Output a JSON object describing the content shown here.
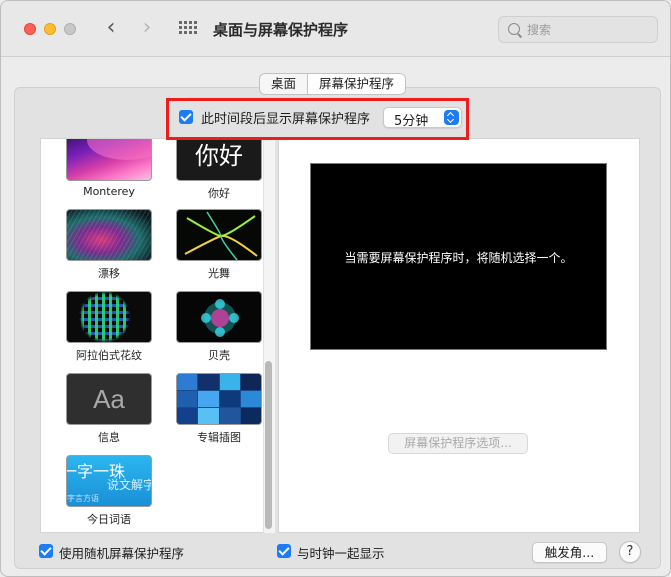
{
  "window": {
    "title": "桌面与屏幕保护程序",
    "search_placeholder": "搜索"
  },
  "icons": {
    "back": "chevron-left-icon",
    "forward": "chevron-right-icon",
    "show_all": "grid-icon",
    "search": "search-icon",
    "stepper": "chevron-up-down-icon"
  },
  "tabs": [
    {
      "label": "桌面",
      "active": false
    },
    {
      "label": "屏幕保护程序",
      "active": true
    }
  ],
  "start_after": {
    "checked": true,
    "label": "此时间段后显示屏幕保护程序",
    "value": "5分钟"
  },
  "savers": [
    {
      "label": "Monterey",
      "thumb_text": ""
    },
    {
      "label": "你好",
      "thumb_text": "你好"
    },
    {
      "label": "漂移",
      "thumb_text": ""
    },
    {
      "label": "光舞",
      "thumb_text": ""
    },
    {
      "label": "阿拉伯式花纹",
      "thumb_text": ""
    },
    {
      "label": "贝壳",
      "thumb_text": ""
    },
    {
      "label": "信息",
      "thumb_text": "Aa"
    },
    {
      "label": "专辑插图",
      "thumb_text": ""
    },
    {
      "label": "今日词语",
      "thumb_text_1": "一字一珠",
      "thumb_text_2": "说文解字",
      "thumb_text_3": "字言方语"
    }
  ],
  "preview": {
    "message": "当需要屏幕保护程序时，将随机选择一个。",
    "options_button": "屏幕保护程序选项..."
  },
  "bottom": {
    "random_checked": true,
    "random_label": "使用随机屏幕保护程序",
    "clock_checked": true,
    "clock_label": "与时钟一起显示",
    "hot_corners": "触发角...",
    "help": "?"
  },
  "colors": {
    "accent": "#1c7cf4",
    "highlight": "#ef1c1c"
  }
}
